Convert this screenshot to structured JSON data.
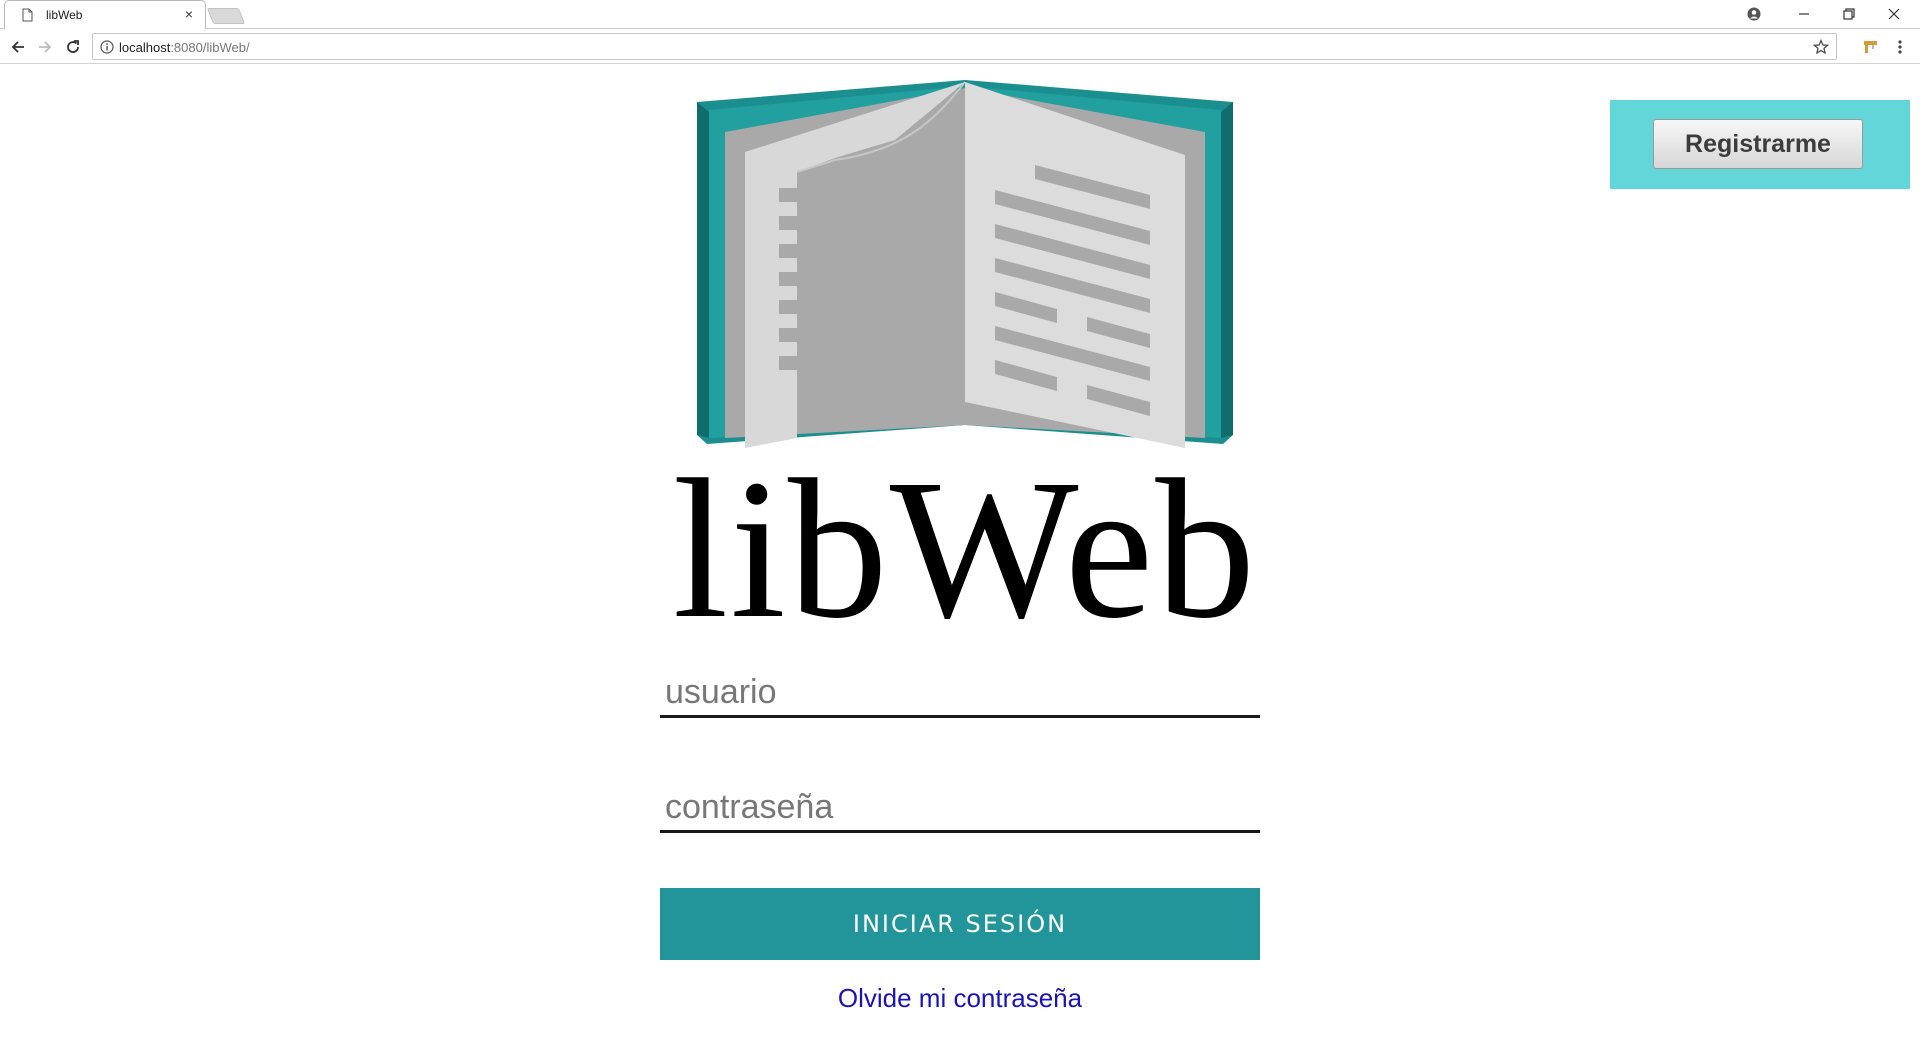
{
  "browser": {
    "tab_title": "libWeb",
    "tab_close": "×",
    "url_host": "localhost",
    "url_rest": ":8080/libWeb/"
  },
  "logo": {
    "text": "libWeb",
    "cover_color": "#1b8f8f",
    "page_color": "#dcdcdc"
  },
  "login": {
    "username_placeholder": "usuario",
    "password_placeholder": "contraseña",
    "submit_label": "INICIAR SESIÓN",
    "forgot_label": "Olvide mi contraseña",
    "accent_color": "#22959a"
  },
  "register": {
    "label": "Registrarme",
    "panel_color": "#62d6d9"
  }
}
